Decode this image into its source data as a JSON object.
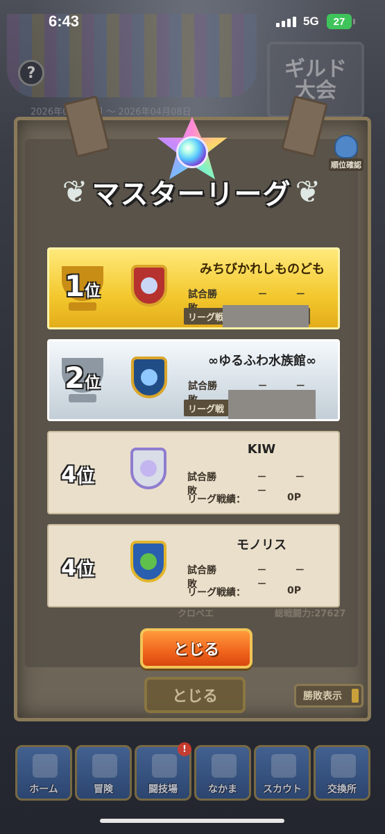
{
  "status_bar": {
    "time": "6:43",
    "network": "5G",
    "battery": "27"
  },
  "background": {
    "guild_sign_line1": "ギルド",
    "guild_sign_line2": "大会",
    "date_range": "2026年04月02日 ～ 2026年04月08日",
    "rank_check_label": "順位確認",
    "help_label": "?",
    "partial_row_name": "クロベエ",
    "partial_row_power": "総戦闘力:27627"
  },
  "modal": {
    "title": "マスターリーグ",
    "laurel_left": "❦",
    "laurel_right": "❦",
    "rankings": [
      {
        "rank": "1",
        "rank_suffix": "位",
        "team": "みちびかれしものども",
        "stat_label": "試合勝敗",
        "stat_value": "－ － －",
        "score_label": "リーグ戦",
        "score_value": ""
      },
      {
        "rank": "2",
        "rank_suffix": "位",
        "team": "∞ゆるふわ水族館∞",
        "stat_label": "試合勝敗",
        "stat_value": "－ － －",
        "score_label": "リーグ戦",
        "score_value": ""
      },
      {
        "rank": "4",
        "rank_suffix": "位",
        "team": "KIW",
        "stat_label": "試合勝敗",
        "stat_value": "－ － －",
        "score_label": "リーグ戦績：",
        "score_value": "0P"
      },
      {
        "rank": "4",
        "rank_suffix": "位",
        "team": "モノリス",
        "stat_label": "試合勝敗",
        "stat_value": "－ － －",
        "score_label": "リーグ戦績：",
        "score_value": "0P"
      }
    ],
    "close_button": "とじる"
  },
  "underlay": {
    "close_button": "とじる",
    "result_toggle": "勝敗表示"
  },
  "nav": {
    "items": [
      {
        "label": "ホーム"
      },
      {
        "label": "冒険"
      },
      {
        "label": "闘技場"
      },
      {
        "label": "なかま"
      },
      {
        "label": "スカウト"
      },
      {
        "label": "交換所"
      }
    ],
    "badge": "!"
  },
  "colors": {
    "gold": "#f3c82e",
    "silver": "#d8e1e8",
    "parchment": "#eadfca",
    "close_orange": "#f0641d",
    "battery_green": "#3fc45b"
  }
}
